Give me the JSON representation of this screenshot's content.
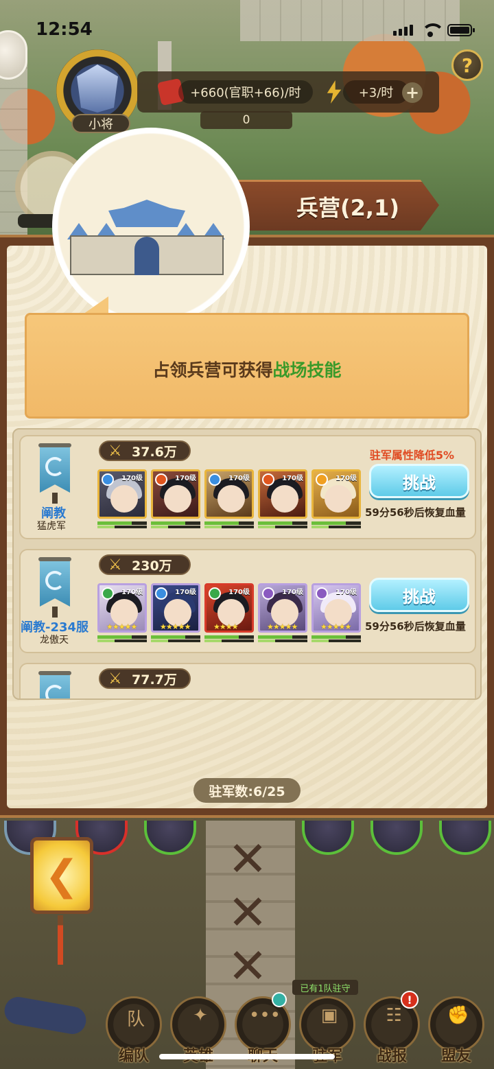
{
  "status_bar": {
    "time": "12:54"
  },
  "header": {
    "help_label": "?",
    "rank_label": "小将",
    "resource_income": "+660(官职+66)/时",
    "energy_income": "+3/时",
    "add_label": "+",
    "secondary_resource": "0"
  },
  "building": {
    "title": "兵营(2,1)",
    "info_prefix": "占领兵营可获得",
    "info_highlight": "战场技能"
  },
  "entries": [
    {
      "power": "37.6万",
      "faction": "阐教",
      "commander": "猛虎军",
      "debuff": "驻军属性降低5%",
      "challenge_label": "挑战",
      "recover_text": "59分56秒后恢复血量",
      "heroes": [
        {
          "level": "170级",
          "stars": "",
          "element": "water",
          "hp": 0.7,
          "mp": 0.35
        },
        {
          "level": "170级",
          "stars": "",
          "element": "fire",
          "hp": 0.7,
          "mp": 0.35
        },
        {
          "level": "170级",
          "stars": "",
          "element": "water",
          "hp": 0.7,
          "mp": 0.35
        },
        {
          "level": "170级",
          "stars": "",
          "element": "fire",
          "hp": 0.7,
          "mp": 0.35
        },
        {
          "level": "170级",
          "stars": "",
          "element": "light",
          "hp": 0.7,
          "mp": 0.35
        }
      ]
    },
    {
      "power": "230万",
      "faction": "阐教-234服",
      "commander": "龙傲天",
      "debuff": "",
      "challenge_label": "挑战",
      "recover_text": "59分56秒后恢复血量",
      "heroes": [
        {
          "level": "170级",
          "stars": "★★★★★",
          "element": "wood",
          "hp": 0.7,
          "mp": 0.35
        },
        {
          "level": "170级",
          "stars": "★★★★★",
          "element": "water",
          "hp": 0.7,
          "mp": 0.35
        },
        {
          "level": "170级",
          "stars": "★★★★",
          "element": "wood",
          "hp": 0.7,
          "mp": 0.35
        },
        {
          "level": "170级",
          "stars": "★★★★★",
          "element": "dark",
          "hp": 0.7,
          "mp": 0.35
        },
        {
          "level": "170级",
          "stars": "★★★★★",
          "element": "dark",
          "hp": 0.7,
          "mp": 0.35
        }
      ]
    },
    {
      "power": "77.7万"
    }
  ],
  "garrison_count": "驻军数:6/25",
  "nav": {
    "items": [
      {
        "label": "编队",
        "icon": "team-icon",
        "glyph": "队"
      },
      {
        "label": "英雄",
        "icon": "hero-icon",
        "glyph": "✦"
      },
      {
        "label": "聊天",
        "icon": "chat-icon",
        "glyph": "•••"
      },
      {
        "label": "驻军",
        "icon": "garrison-icon",
        "glyph": "▣"
      },
      {
        "label": "战报",
        "icon": "report-icon",
        "glyph": "☷"
      },
      {
        "label": "盟友",
        "icon": "ally-icon",
        "glyph": "✊"
      }
    ],
    "garrison_tag": "已有1队驻守",
    "alert": "!"
  },
  "colors": {
    "highlight_green": "#3a9a2a",
    "debuff_red": "#e04a22",
    "faction_blue": "#2a7ad0",
    "challenge_cyan": "#5fcbe8"
  }
}
